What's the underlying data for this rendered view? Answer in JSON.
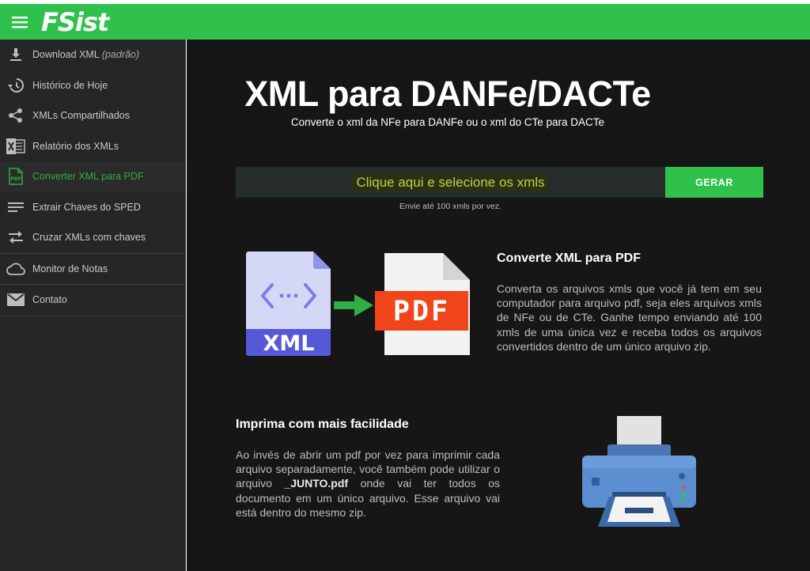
{
  "header": {
    "logo": "FSist"
  },
  "sidebar": {
    "items": [
      {
        "label": "Download XML",
        "suffix": "(padrão)",
        "icon": "download-icon"
      },
      {
        "label": "Histórico de Hoje",
        "icon": "history-icon"
      },
      {
        "label": "XMLs Compartilhados",
        "icon": "share-icon"
      },
      {
        "label": "Relatório dos XMLs",
        "icon": "excel-icon"
      },
      {
        "label": "Converter XML para PDF",
        "icon": "pdf-file-icon",
        "active": true
      },
      {
        "label": "Extrair Chaves do SPED",
        "icon": "lines-icon"
      },
      {
        "label": "Cruzar XMLs com chaves",
        "icon": "swap-arrows-icon"
      },
      {
        "label": "Monitor de Notas",
        "icon": "cloud-icon"
      },
      {
        "label": "Contato",
        "icon": "mail-icon"
      }
    ]
  },
  "main": {
    "title": "XML para DANFe/DACTe",
    "subtitle": "Converte o xml da NFe para DANFe ou o xml do CTe para DACTe",
    "upload_label": "Clique aqui e selecione os xmls",
    "generate_label": "GERAR",
    "hint": "Envie até 100 xmls por vez.",
    "illustration": {
      "xml_label": "XML",
      "pdf_label": "PDF"
    },
    "section1": {
      "heading": "Converte XML para PDF",
      "body": "Converta os arquivos xmls que você já tem em seu computador para arquivo pdf, seja eles arquivos xmls de NFe ou de CTe. Ganhe tempo enviando até 100 xmls de uma única vez e receba todos os arquivos convertidos dentro de um único arquivo zip."
    },
    "section2": {
      "heading": "Imprima com mais facilidade",
      "body_before": "Ao invés de abrir um pdf por vez para imprimir cada arquivo separadamente, você também pode utilizar o arquivo ",
      "body_bold": "_JUNTO.pdf",
      "body_after": " onde vai ter todos os documento em um único arquivo. Esse arquivo vai está dentro do mesmo zip."
    }
  },
  "colors": {
    "brand_green": "#2fc14c",
    "sidebar_bg": "#262626",
    "main_bg": "#161616",
    "upload_text": "#c6cf3a"
  }
}
